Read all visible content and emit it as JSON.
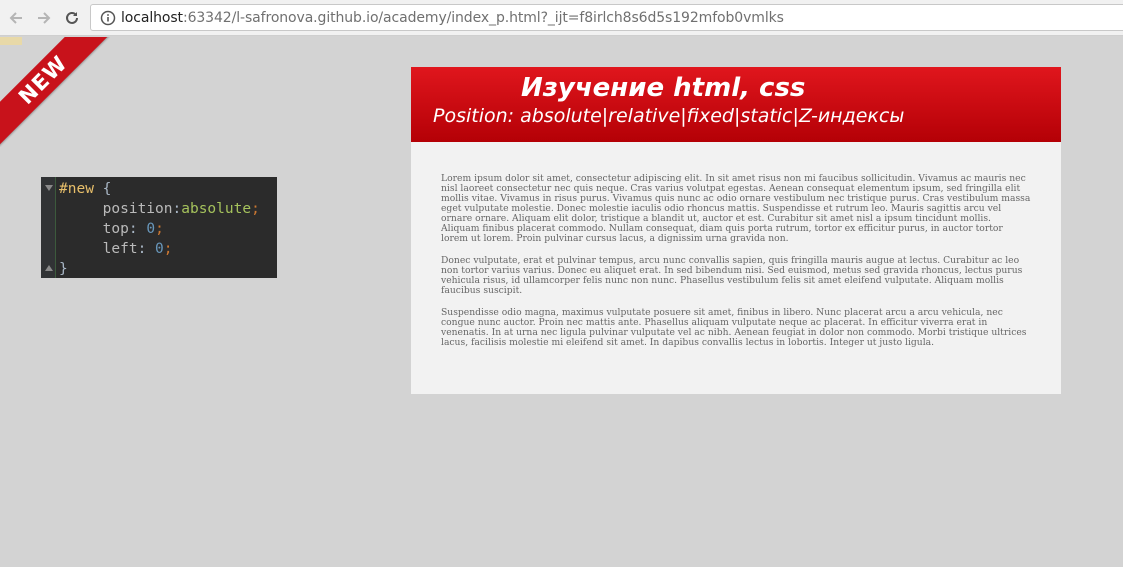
{
  "browser": {
    "url_host": "localhost",
    "url_rest": ":63342/l-safronova.github.io/academy/index_p.html?_ijt=f8irlch8s6d5s192mfob0vmlks",
    "icons": [
      "back-arrow-icon",
      "forward-arrow-icon",
      "reload-icon",
      "info-icon"
    ]
  },
  "ribbon": {
    "label": "NEW",
    "color": "#c8121b"
  },
  "code": {
    "selector": "#new",
    "open_brace": " {",
    "lines": [
      {
        "prop": "position",
        "value": "absolute",
        "value_type": "keyword"
      },
      {
        "prop": "top",
        "value": "0",
        "value_type": "number"
      },
      {
        "prop": "left",
        "value": "0",
        "value_type": "number"
      }
    ],
    "close_brace": "}"
  },
  "card": {
    "title": "Изучение html, css",
    "subtitle": "Position: absolute|relative|fixed|static|Z-индексы",
    "header_color": "#c8121b",
    "paragraphs": [
      "Lorem ipsum dolor sit amet, consectetur adipiscing elit. In sit amet risus non mi faucibus sollicitudin. Vivamus ac mauris nec nisl laoreet consectetur nec quis neque. Cras varius volutpat egestas. Aenean consequat elementum ipsum, sed fringilla elit mollis vitae. Vivamus in risus purus. Vivamus quis nunc ac odio ornare vestibulum nec tristique purus. Cras vestibulum massa eget vulputate molestie. Donec molestie iaculis odio rhoncus mattis. Suspendisse et rutrum leo. Mauris sagittis arcu vel ornare ornare. Aliquam elit dolor, tristique a blandit ut, auctor et est. Curabitur sit amet nisl a ipsum tincidunt mollis. Aliquam finibus placerat commodo. Nullam consequat, diam quis porta rutrum, tortor ex efficitur purus, in auctor tortor lorem ut lorem. Proin pulvinar cursus lacus, a dignissim urna gravida non.",
      "Donec vulputate, erat et pulvinar tempus, arcu nunc convallis sapien, quis fringilla mauris augue at lectus. Curabitur ac leo non tortor varius varius. Donec eu aliquet erat. In sed bibendum nisi. Sed euismod, metus sed gravida rhoncus, lectus purus vehicula risus, id ullamcorper felis nunc non nunc. Phasellus vestibulum felis sit amet eleifend vulputate. Aliquam mollis faucibus suscipit.",
      "Suspendisse odio magna, maximus vulputate posuere sit amet, finibus in libero. Nunc placerat arcu a arcu vehicula, nec congue nunc auctor. Proin nec mattis ante. Phasellus aliquam vulputate neque ac placerat. In efficitur viverra erat in venenatis. In at urna nec ligula pulvinar vulputate vel ac nibh. Aenean feugiat in dolor non commodo. Morbi tristique ultrices lacus, facilisis molestie mi eleifend sit amet. In dapibus convallis lectus in lobortis. Integer ut justo ligula."
    ]
  }
}
